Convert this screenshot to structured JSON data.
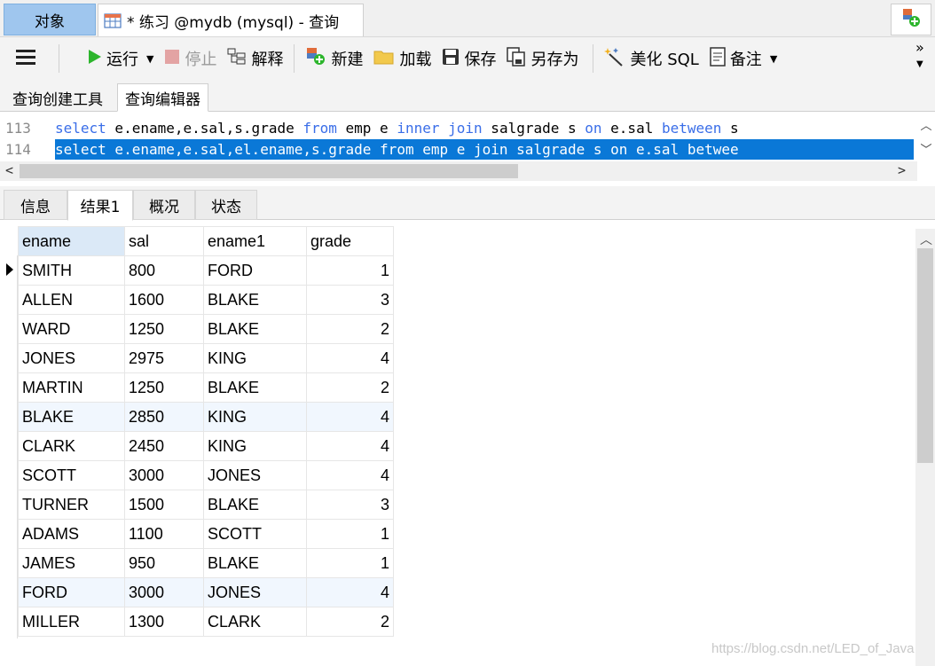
{
  "topbar": {
    "objects_tab": "对象",
    "query_tab_title": "* 练习 @mydb (mysql) - 查询"
  },
  "toolbar": {
    "run": "运行",
    "stop": "停止",
    "explain": "解释",
    "new": "新建",
    "load": "加载",
    "save": "保存",
    "save_as": "另存为",
    "beautify": "美化 SQL",
    "note": "备注"
  },
  "subtabs": {
    "query_builder": "查询创建工具",
    "query_editor": "查询编辑器"
  },
  "editor": {
    "lines": [
      {
        "number": "113",
        "tokens": [
          {
            "t": "select",
            "kw": true
          },
          {
            "t": " e.ename,e.sal,s.grade ",
            "kw": false
          },
          {
            "t": "from",
            "kw": true
          },
          {
            "t": " emp e ",
            "kw": false
          },
          {
            "t": "inner",
            "kw": true
          },
          {
            "t": " ",
            "kw": false
          },
          {
            "t": "join",
            "kw": true
          },
          {
            "t": " salgrade s ",
            "kw": false
          },
          {
            "t": "on",
            "kw": true
          },
          {
            "t": " e.sal ",
            "kw": false
          },
          {
            "t": "between",
            "kw": true
          },
          {
            "t": " s",
            "kw": false
          }
        ]
      },
      {
        "number": "114",
        "selected": true,
        "tokens": [
          {
            "t": "select e.ename,e.sal,el.ename,s.grade from emp e join salgrade s on e.sal betwee",
            "kw": false
          }
        ]
      }
    ]
  },
  "result_tabs": [
    "信息",
    "结果1",
    "概况",
    "状态"
  ],
  "results": {
    "columns": [
      "ename",
      "sal",
      "ename1",
      "grade"
    ],
    "rows": [
      [
        "SMITH",
        "800",
        "FORD",
        "1"
      ],
      [
        "ALLEN",
        "1600",
        "BLAKE",
        "3"
      ],
      [
        "WARD",
        "1250",
        "BLAKE",
        "2"
      ],
      [
        "JONES",
        "2975",
        "KING",
        "4"
      ],
      [
        "MARTIN",
        "1250",
        "BLAKE",
        "2"
      ],
      [
        "BLAKE",
        "2850",
        "KING",
        "4"
      ],
      [
        "CLARK",
        "2450",
        "KING",
        "4"
      ],
      [
        "SCOTT",
        "3000",
        "JONES",
        "4"
      ],
      [
        "TURNER",
        "1500",
        "BLAKE",
        "3"
      ],
      [
        "ADAMS",
        "1100",
        "SCOTT",
        "1"
      ],
      [
        "JAMES",
        "950",
        "BLAKE",
        "1"
      ],
      [
        "FORD",
        "3000",
        "JONES",
        "4"
      ],
      [
        "MILLER",
        "1300",
        "CLARK",
        "2"
      ]
    ],
    "highlighted_rows": [
      5,
      11
    ]
  },
  "watermark": "https://blog.csdn.net/LED_of_Java",
  "colors": {
    "selection": "#0a78d7",
    "keyword": "#3a6ee8",
    "objects_tab": "#9fc6ee",
    "run_icon": "#2cb52c"
  },
  "icons": [
    "query-table-icon",
    "add-connection-icon",
    "menu-icon",
    "play-icon",
    "stop-icon",
    "explain-icon",
    "new-query-icon",
    "folder-icon",
    "save-icon",
    "save-as-icon",
    "magic-wand-icon",
    "note-icon",
    "more-icon",
    "row-marker-icon"
  ]
}
